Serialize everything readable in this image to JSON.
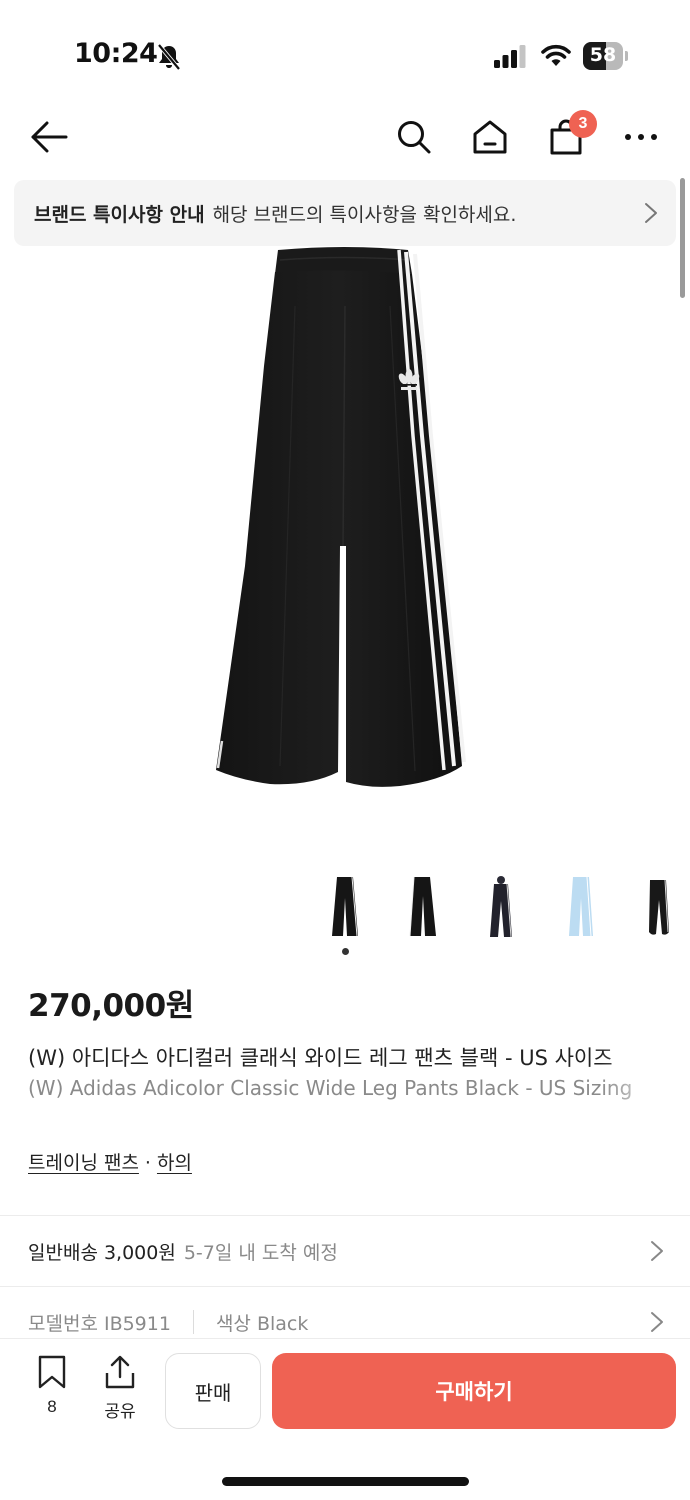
{
  "status_bar": {
    "time": "10:24",
    "battery_level": 58,
    "battery_text": "58"
  },
  "header": {
    "cart_count": "3"
  },
  "notice": {
    "title": "브랜드 특이사항 안내",
    "text": "해당 브랜드의 특이사항을 확인하세요."
  },
  "thumbnails": {
    "count": 5,
    "selected_index": 0
  },
  "product": {
    "price": "270,000원",
    "title_ko": "(W) 아디다스 아디컬러 클래식 와이드 레그 팬츠 블랙 - US 사이즈",
    "title_en": "(W) Adidas Adicolor Classic Wide Leg Pants Black - US Sizing",
    "category_primary": "트레이닝 팬츠",
    "category_separator": "·",
    "category_secondary": "하의"
  },
  "shipping": {
    "label": "일반배송 3,000원",
    "eta": "5-7일 내 도착 예정"
  },
  "details": {
    "model": "모델번호 IB5911",
    "color": "색상 Black"
  },
  "bottom_bar": {
    "bookmark_count": "8",
    "share_label": "공유",
    "sell_label": "판매",
    "buy_label": "구매하기"
  },
  "colors": {
    "accent": "#ef6253",
    "notice_bg": "#f4f4f4",
    "muted_text": "#8a8a8a"
  },
  "icons": [
    "bell-off-icon",
    "signal-icon",
    "wifi-icon",
    "battery-icon",
    "back-arrow-icon",
    "search-icon",
    "home-icon",
    "shopping-bag-icon",
    "more-icon",
    "chevron-right-icon",
    "bookmark-icon",
    "share-icon"
  ]
}
